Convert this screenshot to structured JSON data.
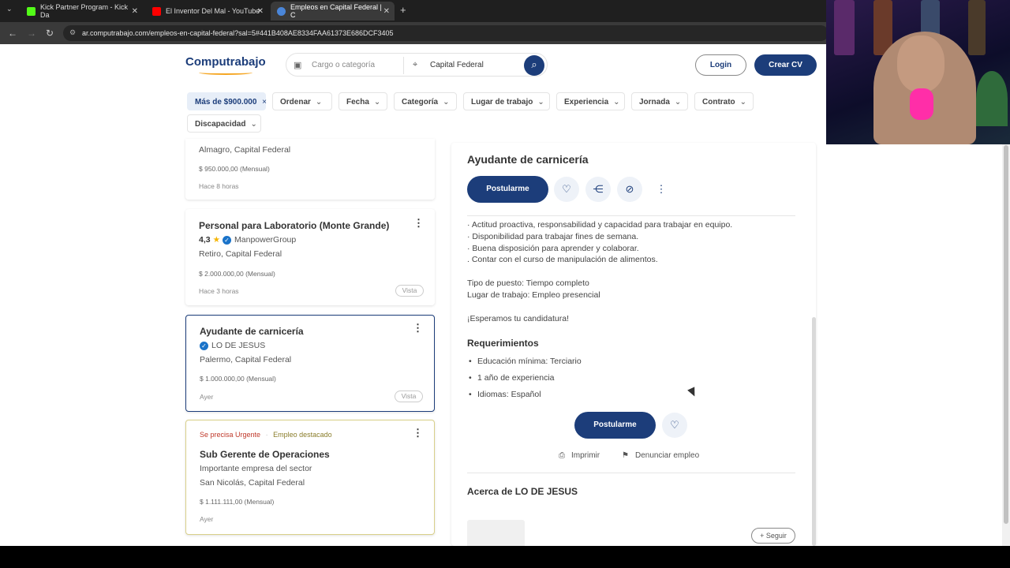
{
  "browser": {
    "tabs": [
      {
        "label": "Kick Partner Program - Kick Da",
        "fav_color": "#53fc18"
      },
      {
        "label": "El Inventor Del Mal - YouTube",
        "fav_color": "#ff0000"
      },
      {
        "label": "Empleos en Capital Federal | C",
        "fav_color": "#4a86d9"
      }
    ],
    "url": "ar.computrabajo.com/empleos-en-capital-federal?sal=5#441B408AE8334FAA61373E686DCF3405"
  },
  "header": {
    "logo": "Computrabajo",
    "search_placeholder": "Cargo o categoría",
    "location": "Capital Federal",
    "login": "Login",
    "create_cv": "Crear CV"
  },
  "filters": {
    "active": "Más de $900.000",
    "items": [
      "Ordenar",
      "Fecha",
      "Categoría",
      "Lugar de trabajo",
      "Experiencia",
      "Jornada",
      "Contrato",
      "Discapacidad"
    ]
  },
  "jobs": [
    {
      "location": "Almagro, Capital Federal",
      "salary": "$ 950.000,00 (Mensual)",
      "when": "Hace 8 horas"
    },
    {
      "title": "Personal para Laboratorio (Monte Grande)",
      "rating": "4,3",
      "company": "ManpowerGroup",
      "location": "Retiro, Capital Federal",
      "salary": "$ 2.000.000,00 (Mensual)",
      "when": "Hace 3 horas",
      "badge": "Vista"
    },
    {
      "title": "Ayudante de carnicería",
      "company": "LO DE JESUS",
      "location": "Palermo, Capital Federal",
      "salary": "$ 1.000.000,00 (Mensual)",
      "when": "Ayer",
      "badge": "Vista"
    },
    {
      "urgent": "Se precisa Urgente",
      "featured": "Empleo destacado",
      "title": "Sub Gerente de Operaciones",
      "company": "Importante empresa del sector",
      "location": "San Nicolás, Capital Federal",
      "salary": "$ 1.111.111,00 (Mensual)",
      "when": "Ayer"
    }
  ],
  "detail": {
    "title": "Ayudante de carnicería",
    "apply": "Postularme",
    "lines": [
      "· Actitud proactiva, responsabilidad y capacidad para trabajar en equipo.",
      "· Disponibilidad para trabajar fines de semana.",
      "· Buena disposición para aprender y colaborar.",
      ". Contar con el curso de manipulación de alimentos."
    ],
    "tipo": "Tipo de puesto: Tiempo completo",
    "lugar": "Lugar de trabajo: Empleo presencial",
    "closing": "¡Esperamos tu candidatura!",
    "req_title": "Requerimientos",
    "requirements": [
      "Educación mínima: Terciario",
      "1 año de experiencia",
      "Idiomas: Español"
    ],
    "print": "Imprimir",
    "report": "Denunciar empleo",
    "about": "Acerca de LO DE JESUS",
    "follow": "+ Seguir"
  },
  "colors": {
    "brand": "#1c3d7a",
    "accent": "#f5a623"
  }
}
